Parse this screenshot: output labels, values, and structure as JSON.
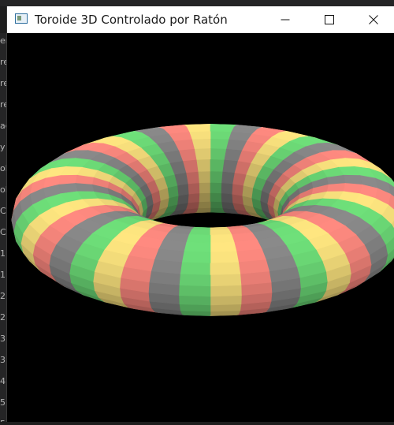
{
  "window": {
    "title": "Toroide 3D Controlado por Ratón"
  },
  "controls": {
    "minimize_icon": "minimize-icon",
    "maximize_icon": "maximize-icon",
    "close_icon": "close-icon"
  },
  "torus": {
    "stripe_colors": [
      "#ff8a80",
      "#ffe680",
      "#6fe07a",
      "#8a8a8a"
    ],
    "background": "#000000"
  },
  "editor_gutter_chars": [
    "er.py",
    "re",
    "re",
    "re",
    "ac",
    "y",
    "ol",
    "ol",
    "Co",
    "Co",
    "1",
    "1",
    "2",
    "2",
    "3",
    "3",
    "4",
    "5",
    "5"
  ]
}
